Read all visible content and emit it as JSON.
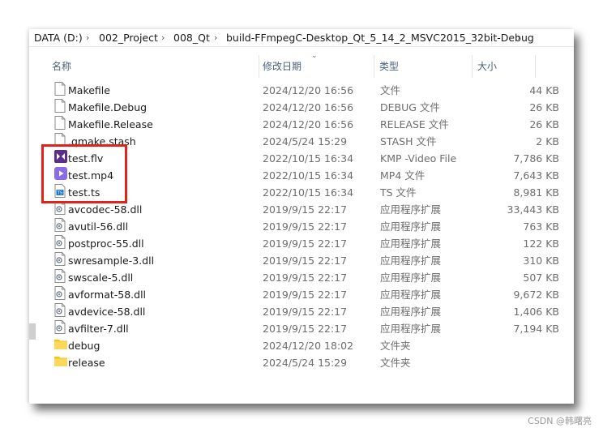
{
  "breadcrumb": [
    "DATA (D:)",
    "002_Project",
    "008_Qt",
    "build-FFmpegC-Desktop_Qt_5_14_2_MSVC2015_32bit-Debug"
  ],
  "columns": {
    "name": "名称",
    "date": "修改日期",
    "type": "类型",
    "size": "大小"
  },
  "files": [
    {
      "name": "Makefile",
      "date": "2024/12/20 16:56",
      "type": "文件",
      "size": "44 KB",
      "icon": "file-icon"
    },
    {
      "name": "Makefile.Debug",
      "date": "2024/12/20 16:56",
      "type": "DEBUG 文件",
      "size": "26 KB",
      "icon": "file-icon"
    },
    {
      "name": "Makefile.Release",
      "date": "2024/12/20 16:56",
      "type": "RELEASE 文件",
      "size": "26 KB",
      "icon": "file-icon"
    },
    {
      "name": ".qmake.stash",
      "date": "2024/5/24 15:29",
      "type": "STASH 文件",
      "size": "2 KB",
      "icon": "file-icon"
    },
    {
      "name": "test.flv",
      "date": "2022/10/15 16:34",
      "type": "KMP -Video File",
      "size": "7,786 KB",
      "icon": "kmp-video-icon"
    },
    {
      "name": "test.mp4",
      "date": "2022/10/15 16:34",
      "type": "MP4 文件",
      "size": "7,643 KB",
      "icon": "mp4-video-icon"
    },
    {
      "name": "test.ts",
      "date": "2022/10/15 16:34",
      "type": "TS 文件",
      "size": "8,981 KB",
      "icon": "ts-video-icon"
    },
    {
      "name": "avcodec-58.dll",
      "date": "2019/9/15 22:17",
      "type": "应用程序扩展",
      "size": "33,443 KB",
      "icon": "dll-icon"
    },
    {
      "name": "avutil-56.dll",
      "date": "2019/9/15 22:17",
      "type": "应用程序扩展",
      "size": "763 KB",
      "icon": "dll-icon"
    },
    {
      "name": "postproc-55.dll",
      "date": "2019/9/15 22:17",
      "type": "应用程序扩展",
      "size": "122 KB",
      "icon": "dll-icon"
    },
    {
      "name": "swresample-3.dll",
      "date": "2019/9/15 22:17",
      "type": "应用程序扩展",
      "size": "310 KB",
      "icon": "dll-icon"
    },
    {
      "name": "swscale-5.dll",
      "date": "2019/9/15 22:17",
      "type": "应用程序扩展",
      "size": "507 KB",
      "icon": "dll-icon"
    },
    {
      "name": "avformat-58.dll",
      "date": "2019/9/15 22:17",
      "type": "应用程序扩展",
      "size": "9,672 KB",
      "icon": "dll-icon"
    },
    {
      "name": "avdevice-58.dll",
      "date": "2019/9/15 22:17",
      "type": "应用程序扩展",
      "size": "1,406 KB",
      "icon": "dll-icon"
    },
    {
      "name": "avfilter-7.dll",
      "date": "2019/9/15 22:17",
      "type": "应用程序扩展",
      "size": "7,194 KB",
      "icon": "dll-icon"
    },
    {
      "name": "debug",
      "date": "2024/12/20 18:02",
      "type": "文件夹",
      "size": "",
      "icon": "folder-icon"
    },
    {
      "name": "release",
      "date": "2024/5/24 15:29",
      "type": "文件夹",
      "size": "",
      "icon": "folder-icon"
    }
  ],
  "watermark": "CSDN @韩曙亮",
  "colors": {
    "highlight": "#e0231b",
    "header_text": "#4c607a",
    "folder": "#f5c518"
  }
}
